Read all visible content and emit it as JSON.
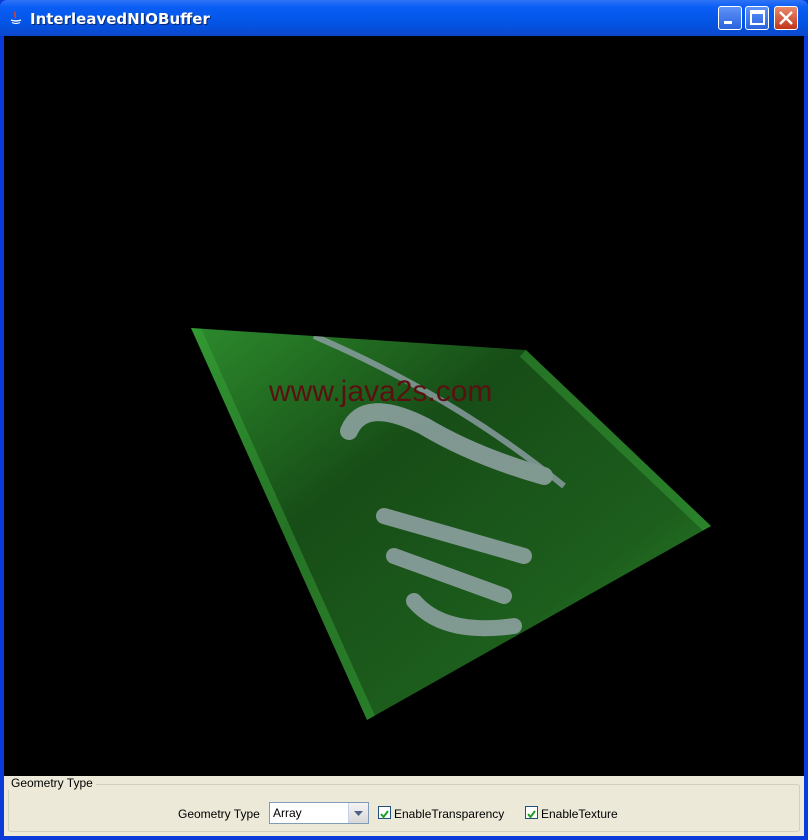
{
  "window": {
    "title": "InterleavedNIOBuffer"
  },
  "scene": {
    "watermark": "www.java2s.com"
  },
  "controls": {
    "group_title": "Geometry Type",
    "geometry_label": "Geometry Type",
    "geometry_value": "Array",
    "transparency_label": "EnableTransparency",
    "transparency_checked": true,
    "texture_label": "EnableTexture",
    "texture_checked": true
  },
  "colors": {
    "titlebar": "#0a5ef5",
    "panel": "#ece9d8",
    "canvas": "#000000",
    "plane_green": "#1f7a1f"
  }
}
